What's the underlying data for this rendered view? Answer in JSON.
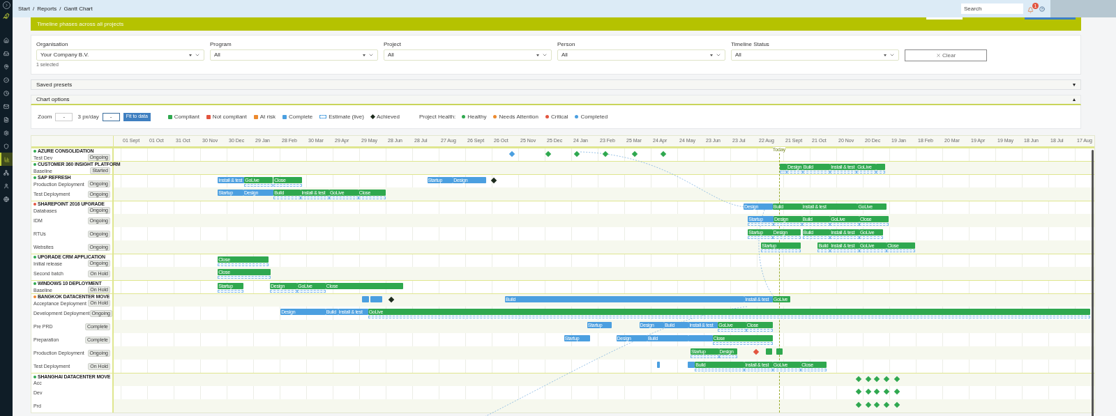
{
  "sidebar": {
    "items": [
      {
        "selected": false
      },
      {
        "selected": false
      },
      {
        "selected": false
      },
      {
        "selected": false
      },
      {
        "selected": false
      },
      {
        "selected": false
      },
      {
        "selected": false
      },
      {
        "selected": false
      },
      {
        "selected": false
      },
      {
        "selected": true
      },
      {
        "selected": false
      },
      {
        "selected": false
      },
      {
        "selected": false
      }
    ]
  },
  "breadcrumb": [
    "Start",
    "Reports",
    "Gantt Chart"
  ],
  "breadcrumb_separator": "/",
  "search": {
    "placeholder": "Search"
  },
  "notifications": {
    "badge": "1"
  },
  "banner": {
    "text": "Timeline phases across all projects"
  },
  "filters": [
    {
      "label": "Organisation",
      "value": "Your Company B.V.",
      "note": "1 selected"
    },
    {
      "label": "Program",
      "value": "All"
    },
    {
      "label": "Project",
      "value": "All"
    },
    {
      "label": "Person",
      "value": "All"
    },
    {
      "label": "Timeline Status",
      "value": "All"
    }
  ],
  "clear_button": "Clear",
  "sections": [
    {
      "title": "Saved presets",
      "expanded": false
    },
    {
      "title": "Chart options",
      "expanded": true
    }
  ],
  "chart_options": {
    "zoom_label": "Zoom",
    "zoom_value": "-",
    "scale_label": "3 px/day",
    "scale_value": "-",
    "fit_button": "Fit to data"
  },
  "legend": [
    {
      "label": "Compliant",
      "kind": "swatch",
      "color": "#2fa84f"
    },
    {
      "label": "Not compliant",
      "kind": "swatch",
      "color": "#e2553f"
    },
    {
      "label": "At risk",
      "kind": "swatch",
      "color": "#ec8a2e"
    },
    {
      "label": "Complete",
      "kind": "swatch",
      "color": "#4b9fe0"
    },
    {
      "label": "Estimate (live)",
      "kind": "dashed",
      "color": "#4b9fe0"
    },
    {
      "label": "Achieved",
      "kind": "diamond",
      "color": "#1d2b1d"
    }
  ],
  "health_legend": {
    "title": "Project Health:",
    "items": [
      {
        "label": "Healthy",
        "color": "#2fa84f"
      },
      {
        "label": "Needs Attention",
        "color": "#ec8a2e"
      },
      {
        "label": "Critical",
        "color": "#e2553f"
      },
      {
        "label": "Completed",
        "color": "#4b9fe0"
      }
    ]
  },
  "timeline": {
    "columns": [
      "01 Sept",
      "01 Oct",
      "31 Oct",
      "30 Nov",
      "30 Dec",
      "29 Jan",
      "28 Feb",
      "30 Mar",
      "29 Apr",
      "29 May",
      "28 Jun",
      "28 Jul",
      "27 Aug",
      "26 Sept",
      "26 Oct",
      "25 Nov",
      "25 Dec",
      "24 Jan",
      "23 Feb",
      "25 Mar",
      "24 Apr",
      "24 May",
      "23 Jun",
      "23 Jul",
      "22 Aug",
      "21 Sept",
      "21 Oct",
      "20 Nov",
      "20 Dec",
      "19 Jan",
      "18 Feb",
      "20 Mar",
      "19 Apr",
      "19 May",
      "18 Jun",
      "18 Jul",
      "17 Aug"
    ],
    "today_label": "Today"
  },
  "groups": [
    {
      "name": "AZURE CONSOLIDATION",
      "color": "#2fa84f",
      "rows": [
        {
          "name": "Test Dev",
          "badge": "Ongoing",
          "items": [
            {
              "kind": "milestone",
              "color": "#4b9fe0"
            },
            {
              "kind": "milestone",
              "color": "#2fa84f"
            },
            {
              "kind": "milestone",
              "color": "#2fa84f"
            },
            {
              "kind": "milestone",
              "color": "#2fa84f"
            },
            {
              "kind": "milestone",
              "color": "#2fa84f"
            },
            {
              "kind": "milestone",
              "color": "#2fa84f"
            }
          ]
        }
      ]
    },
    {
      "name": "CUSTOMER 360 INSIGHT PLATFORM",
      "color": "#2fa84f",
      "rows": [
        {
          "name": "Baseline",
          "badge": "Started",
          "items": [
            {
              "kind": "bar",
              "color": "#2fa84f",
              "estimate": true
            },
            {
              "kind": "bar",
              "label": "Design",
              "color": "#2fa84f",
              "estimate": true
            },
            {
              "kind": "bar",
              "label": "Build",
              "color": "#2fa84f",
              "estimate": true
            },
            {
              "kind": "bar",
              "label": "Install & test",
              "color": "#2fa84f",
              "estimate": true
            },
            {
              "kind": "bar",
              "label": "GoLive",
              "color": "#2fa84f",
              "estimate": true
            },
            {
              "kind": "bar",
              "color": "#2fa84f",
              "estimate": true
            }
          ]
        }
      ]
    },
    {
      "name": "SAP REFRESH",
      "color": "#2fa84f",
      "rows": [
        {
          "name": "Production Deployment",
          "badge": "Ongoing",
          "items": [
            {
              "kind": "bar",
              "label": "Install & test",
              "color": "#4b9fe0",
              "estimate": false
            },
            {
              "kind": "bar",
              "label": "GoLive",
              "color": "#2fa84f",
              "estimate": true
            },
            {
              "kind": "bar",
              "label": "Close",
              "color": "#2fa84f",
              "estimate": true
            },
            {
              "kind": "bar",
              "label": "Startup",
              "color": "#4b9fe0",
              "estimate": false
            },
            {
              "kind": "bar",
              "label": "Design",
              "color": "#4b9fe0",
              "estimate": false
            },
            {
              "kind": "milestone",
              "color": "#1d2b1d"
            }
          ]
        },
        {
          "name": "Test Deployment",
          "badge": "Ongoing",
          "items": [
            {
              "kind": "bar",
              "label": "Startup",
              "color": "#4b9fe0",
              "estimate": false
            },
            {
              "kind": "bar",
              "label": "Design",
              "color": "#4b9fe0",
              "estimate": false
            },
            {
              "kind": "bar",
              "label": "Build",
              "color": "#2fa84f",
              "estimate": true
            },
            {
              "kind": "bar",
              "label": "Install & test",
              "color": "#2fa84f",
              "estimate": true
            },
            {
              "kind": "bar",
              "label": "GoLive",
              "color": "#2fa84f",
              "estimate": true
            },
            {
              "kind": "bar",
              "label": "Close",
              "color": "#2fa84f",
              "estimate": true
            }
          ]
        }
      ]
    },
    {
      "name": "SHAREPOINT 2016 UPGRADE",
      "color": "#e2553f",
      "rows": [
        {
          "name": "Databases",
          "badge": "Ongoing",
          "items": [
            {
              "kind": "bar",
              "label": "Design",
              "color": "#4b9fe0",
              "estimate": false
            },
            {
              "kind": "bar",
              "label": "Build",
              "color": "#2fa84f",
              "estimate": false
            },
            {
              "kind": "bar",
              "label": "Install & test",
              "color": "#2fa84f",
              "estimate": false
            },
            {
              "kind": "bar",
              "label": "GoLive",
              "color": "#2fa84f",
              "estimate": false
            }
          ]
        },
        {
          "name": "IDM",
          "badge": "Ongoing",
          "items": [
            {
              "kind": "bar",
              "label": "Startup",
              "color": "#4b9fe0",
              "estimate": true
            },
            {
              "kind": "bar",
              "label": "Design",
              "color": "#2fa84f",
              "estimate": true
            },
            {
              "kind": "bar",
              "label": "Build",
              "color": "#2fa84f",
              "estimate": true
            },
            {
              "kind": "bar",
              "label": "GoLive",
              "color": "#2fa84f",
              "estimate": true
            },
            {
              "kind": "bar",
              "label": "Close",
              "color": "#2fa84f",
              "estimate": true
            }
          ]
        },
        {
          "name": "RTUs",
          "badge": "Ongoing",
          "items": [
            {
              "kind": "bar",
              "label": "Startup",
              "color": "#2fa84f",
              "estimate": true
            },
            {
              "kind": "bar",
              "label": "Design",
              "color": "#2fa84f",
              "estimate": true
            },
            {
              "kind": "bar",
              "label": "Build",
              "color": "#2fa84f",
              "estimate": true
            },
            {
              "kind": "bar",
              "label": "Install & test",
              "color": "#2fa84f",
              "estimate": true
            },
            {
              "kind": "bar",
              "label": "GoLive",
              "color": "#2fa84f",
              "estimate": true
            }
          ]
        },
        {
          "name": "Websites",
          "badge": "Ongoing",
          "items": [
            {
              "kind": "bar",
              "label": "Startup",
              "color": "#2fa84f",
              "estimate": true
            },
            {
              "kind": "bar",
              "label": "Build",
              "color": "#2fa84f",
              "estimate": true
            },
            {
              "kind": "bar",
              "label": "Install & test",
              "color": "#2fa84f",
              "estimate": true
            },
            {
              "kind": "bar",
              "label": "GoLive",
              "color": "#2fa84f",
              "estimate": true
            },
            {
              "kind": "bar",
              "label": "Close",
              "color": "#2fa84f",
              "estimate": true
            }
          ]
        }
      ]
    },
    {
      "name": "UPGRADE CRM APPLICATION",
      "color": "#2fa84f",
      "rows": [
        {
          "name": "Initial release",
          "badge": "Ongoing",
          "items": [
            {
              "kind": "bar",
              "label": "Close",
              "color": "#2fa84f",
              "estimate": true
            }
          ]
        },
        {
          "name": "Second batch",
          "badge": "On Hold",
          "items": [
            {
              "kind": "bar",
              "label": "Close",
              "color": "#2fa84f",
              "estimate": true
            }
          ]
        }
      ]
    },
    {
      "name": "WINDOWS 10 DEPLOYMENT",
      "color": "#2fa84f",
      "rows": [
        {
          "name": "Baseline",
          "badge": "On Hold",
          "items": [
            {
              "kind": "bar",
              "label": "Startup",
              "color": "#2fa84f",
              "estimate": true
            },
            {
              "kind": "bar",
              "label": "Design",
              "color": "#2fa84f",
              "estimate": true
            },
            {
              "kind": "bar",
              "label": "GoLive",
              "color": "#2fa84f",
              "estimate": true
            },
            {
              "kind": "bar",
              "label": "Close",
              "color": "#2fa84f",
              "estimate": false
            }
          ]
        }
      ]
    },
    {
      "name": "BANGKOK DATACENTER MOVE",
      "color": "#ec8a2e",
      "rows": [
        {
          "name": "Acceptance Deployment",
          "badge": "On Hold",
          "items": [
            {
              "kind": "bar",
              "color": "#4b9fe0",
              "estimate": false
            },
            {
              "kind": "bar",
              "color": "#4b9fe0",
              "estimate": false
            },
            {
              "kind": "milestone",
              "color": "#1d2b1d"
            },
            {
              "kind": "bar",
              "label": "Build",
              "color": "#4b9fe0",
              "estimate": false
            },
            {
              "kind": "bar",
              "label": "Install & test",
              "color": "#4b9fe0",
              "estimate": false
            },
            {
              "kind": "bar",
              "label": "GoLive",
              "color": "#2fa84f",
              "estimate": false
            }
          ]
        },
        {
          "name": "Development Deployment",
          "badge": "Ongoing",
          "items": [
            {
              "kind": "bar",
              "label": "Design",
              "color": "#4b9fe0",
              "estimate": false
            },
            {
              "kind": "bar",
              "label": "Build",
              "color": "#4b9fe0",
              "estimate": false
            },
            {
              "kind": "bar",
              "label": "Install & test",
              "color": "#4b9fe0",
              "estimate": false
            },
            {
              "kind": "bar",
              "label": "GoLive",
              "color": "#2fa84f",
              "estimate": true
            }
          ]
        },
        {
          "name": "Pre PRD",
          "badge": "Complete",
          "items": [
            {
              "kind": "bar",
              "label": "Startup",
              "color": "#4b9fe0",
              "estimate": false
            },
            {
              "kind": "bar",
              "label": "Design",
              "color": "#4b9fe0",
              "estimate": false
            },
            {
              "kind": "bar",
              "label": "Build",
              "color": "#4b9fe0",
              "estimate": false
            },
            {
              "kind": "bar",
              "label": "Install & test",
              "color": "#4b9fe0",
              "estimate": false
            },
            {
              "kind": "bar",
              "label": "GoLive",
              "color": "#2fa84f",
              "estimate": true
            },
            {
              "kind": "bar",
              "label": "Close",
              "color": "#2fa84f",
              "estimate": true
            }
          ]
        },
        {
          "name": "Preparation",
          "badge": "Complete",
          "items": [
            {
              "kind": "bar",
              "label": "Startup",
              "color": "#4b9fe0",
              "estimate": false
            },
            {
              "kind": "bar",
              "label": "Design",
              "color": "#4b9fe0",
              "estimate": false
            },
            {
              "kind": "bar",
              "label": "Build",
              "color": "#4b9fe0",
              "estimate": false
            },
            {
              "kind": "bar",
              "color": "#4b9fe0",
              "estimate": false
            },
            {
              "kind": "bar",
              "label": "Close",
              "color": "#2fa84f",
              "estimate": true
            }
          ]
        },
        {
          "name": "Production Deployment",
          "badge": "Ongoing",
          "items": [
            {
              "kind": "bar",
              "label": "Startup",
              "color": "#2fa84f",
              "estimate": true
            },
            {
              "kind": "bar",
              "label": "Design",
              "color": "#2fa84f",
              "estimate": true
            },
            {
              "kind": "milestone",
              "color": "#e2553f"
            },
            {
              "kind": "bar",
              "color": "#2fa84f",
              "estimate": false
            },
            {
              "kind": "bar",
              "color": "#2fa84f",
              "estimate": false
            }
          ]
        },
        {
          "name": "Test Deployment",
          "badge": "On Hold",
          "items": [
            {
              "kind": "bar",
              "color": "#4b9fe0",
              "estimate": false
            },
            {
              "kind": "bar",
              "color": "#4b9fe0",
              "estimate": false
            },
            {
              "kind": "bar",
              "label": "Build",
              "color": "#2fa84f",
              "estimate": true
            },
            {
              "kind": "bar",
              "label": "Install & test",
              "color": "#2fa84f",
              "estimate": true
            },
            {
              "kind": "bar",
              "label": "GoLive",
              "color": "#2fa84f",
              "estimate": true
            },
            {
              "kind": "bar",
              "label": "Close",
              "color": "#2fa84f",
              "estimate": true
            }
          ]
        }
      ]
    },
    {
      "name": "SHANGHAI DATACENTER MOVE",
      "color": "#2fa84f",
      "rows": [
        {
          "name": "Acc",
          "items": [
            {
              "kind": "milestone",
              "color": "#2fa84f"
            },
            {
              "kind": "milestone",
              "color": "#2fa84f"
            },
            {
              "kind": "milestone",
              "color": "#2fa84f"
            },
            {
              "kind": "milestone",
              "color": "#2fa84f"
            },
            {
              "kind": "milestone",
              "color": "#2fa84f"
            }
          ]
        },
        {
          "name": "Dev",
          "items": [
            {
              "kind": "milestone",
              "color": "#2fa84f"
            },
            {
              "kind": "milestone",
              "color": "#2fa84f"
            },
            {
              "kind": "milestone",
              "color": "#2fa84f"
            },
            {
              "kind": "milestone",
              "color": "#2fa84f"
            },
            {
              "kind": "milestone",
              "color": "#2fa84f"
            }
          ]
        },
        {
          "name": "Prd",
          "items": [
            {
              "kind": "milestone",
              "color": "#2fa84f"
            },
            {
              "kind": "milestone",
              "color": "#2fa84f"
            },
            {
              "kind": "milestone",
              "color": "#2fa84f"
            },
            {
              "kind": "milestone",
              "color": "#2fa84f"
            },
            {
              "kind": "milestone",
              "color": "#2fa84f"
            }
          ]
        }
      ]
    }
  ]
}
